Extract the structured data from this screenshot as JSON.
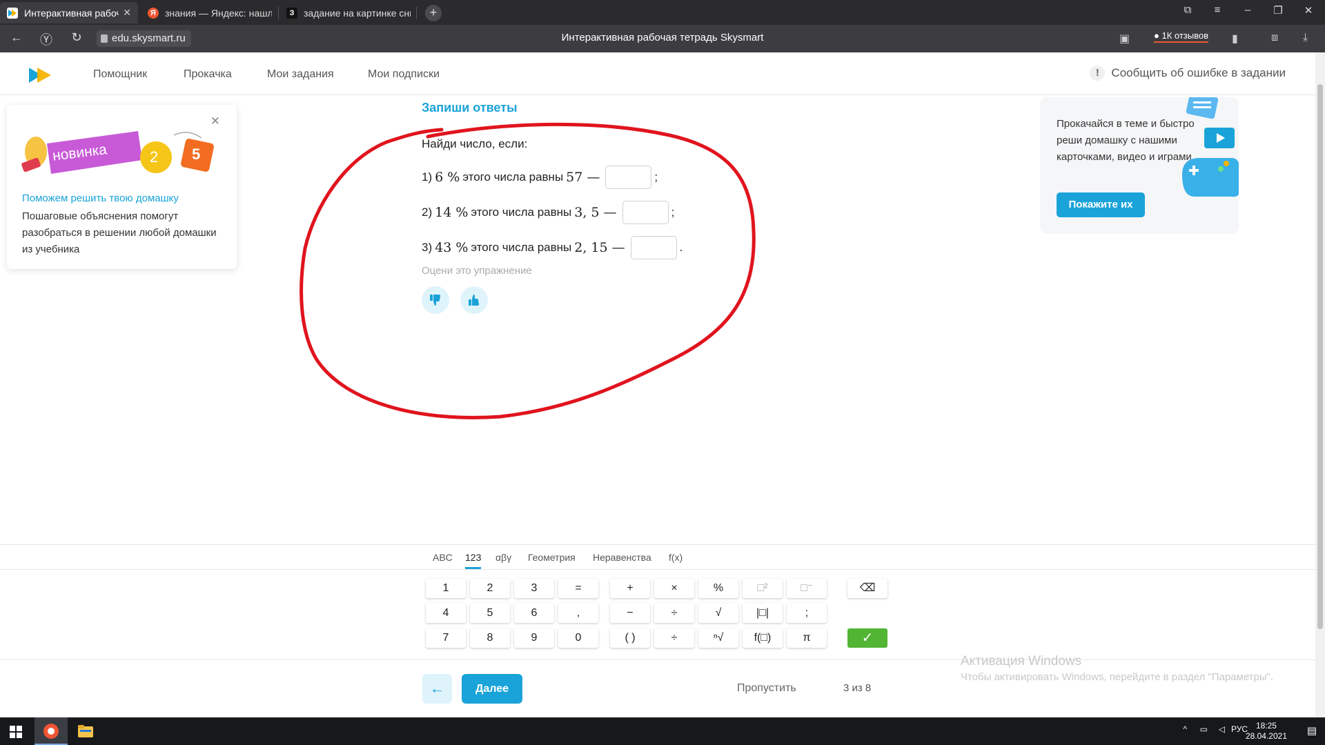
{
  "browser": {
    "tabs": [
      {
        "title": "Интерактивная рабоч",
        "active": true
      },
      {
        "title": "знания — Яндекс: нашлос",
        "active": false
      },
      {
        "title": "задание на картинке сни",
        "active": false
      }
    ],
    "url": "edu.skysmart.ru",
    "page_title": "Интерактивная рабочая тетрадь Skysmart",
    "reviews_label": "1К отзывов"
  },
  "site_header": {
    "menu": [
      "Помощник",
      "Прокачка",
      "Мои задания",
      "Мои подписки"
    ],
    "report_label": "Сообщить об ошибке в задании"
  },
  "left_promo": {
    "badge_text": "новинка",
    "num_a": "2",
    "num_b": "5",
    "link": "Поможем решить твою домашку",
    "text": "Пошаговые объяснения помогут разобраться в решении любой домашки из учебника"
  },
  "right_promo": {
    "text": "Прокачайся в теме и быстро реши домашку с нашими карточками, видео и играми",
    "button": "Покажите их"
  },
  "task": {
    "title": "Запиши ответы",
    "intro": "Найди число, если:",
    "items": [
      {
        "num": "1)",
        "percent": "6 %",
        "mid": "этого числа равны",
        "value": "57 —",
        "end": ";"
      },
      {
        "num": "2)",
        "percent": "14 %",
        "mid": "этого числа равны",
        "value": "3, 5 —",
        "end": ";"
      },
      {
        "num": "3)",
        "percent": "43 %",
        "mid": "этого числа равны",
        "value": "2, 15 —",
        "end": "."
      }
    ],
    "rate_label": "Оцени это упражнение"
  },
  "keyboard": {
    "tabs": [
      "ABC",
      "123",
      "αβγ",
      "Геометрия",
      "Неравенства",
      "f(x)"
    ],
    "active_tab": "123",
    "digits": [
      "1",
      "2",
      "3",
      "=",
      "4",
      "5",
      "6",
      ",",
      "7",
      "8",
      "9",
      "0"
    ],
    "ops": [
      "+",
      "×",
      "%",
      "□²",
      "□⁻",
      "−",
      "÷",
      "√",
      "|□|",
      ";",
      "( )",
      "÷",
      "ⁿ√",
      "f(□)",
      "π"
    ],
    "backspace": "⌫",
    "confirm": "✓"
  },
  "footer": {
    "back": "←",
    "next": "Далее",
    "skip": "Пропустить",
    "progress": "3 из 8"
  },
  "activation": {
    "title": "Активация Windows",
    "text": "Чтобы активировать Windows, перейдите в раздел \"Параметры\"."
  },
  "taskbar": {
    "lang": "РУС",
    "time": "18:25",
    "date": "28.04.2021"
  },
  "colors": {
    "accent": "#1aa3d8",
    "annotation": "#e0141e",
    "confirm": "#52b533"
  }
}
